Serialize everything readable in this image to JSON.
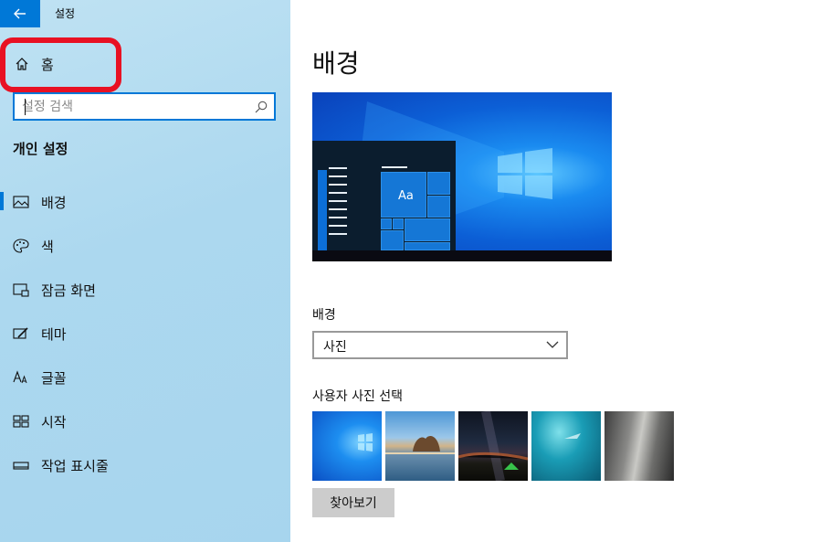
{
  "window": {
    "title": "설정",
    "back_icon": "back-arrow-icon",
    "accent": "#0078d7"
  },
  "sidebar": {
    "home_label": "홈",
    "home_icon": "home-icon",
    "search": {
      "placeholder": "설정 검색",
      "icon": "search-icon"
    },
    "section_title": "개인 설정",
    "items": [
      {
        "label": "배경",
        "icon": "picture-icon",
        "selected": true
      },
      {
        "label": "색",
        "icon": "palette-icon",
        "selected": false
      },
      {
        "label": "잠금 화면",
        "icon": "lock-screen-icon",
        "selected": false
      },
      {
        "label": "테마",
        "icon": "theme-brush-icon",
        "selected": false
      },
      {
        "label": "글꼴",
        "icon": "font-icon",
        "selected": false
      },
      {
        "label": "시작",
        "icon": "start-grid-icon",
        "selected": false
      },
      {
        "label": "작업 표시줄",
        "icon": "taskbar-icon",
        "selected": false
      }
    ],
    "highlight_color": "#e81123"
  },
  "main": {
    "title": "배경",
    "preview": {
      "tile_text": "Aa"
    },
    "background_field": {
      "label": "배경",
      "value": "사진",
      "icon": "chevron-down-icon"
    },
    "choose_label": "사용자 사진 선택",
    "thumbnails": [
      "windows-light-thumbnail",
      "beach-rock-thumbnail",
      "night-sky-tent-thumbnail",
      "underwater-swimmer-thumbnail",
      "rock-cliff-thumbnail"
    ],
    "browse_label": "찾아보기"
  }
}
